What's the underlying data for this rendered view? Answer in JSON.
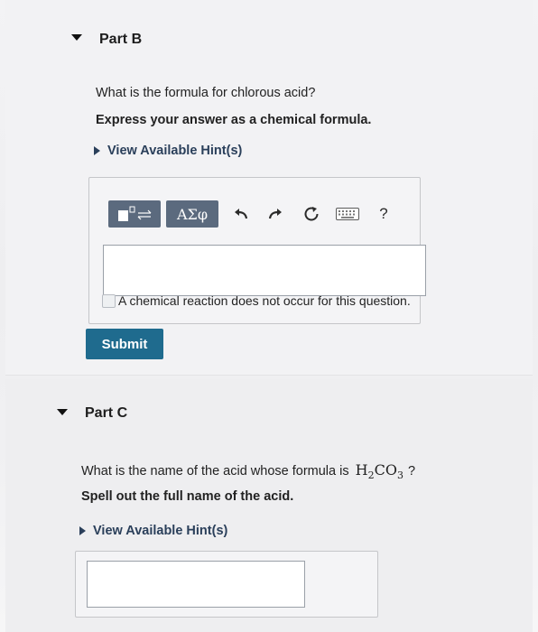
{
  "part_b": {
    "title": "Part B",
    "question": "What is the formula for chlorous acid?",
    "instruction": "Express your answer as a chemical formula.",
    "hint_label": "View Available Hint(s)",
    "toolbar": {
      "template_icon": "template-icon",
      "symbols_label": "ΑΣφ",
      "undo_icon": "undo-icon",
      "redo_icon": "redo-icon",
      "reset_icon": "reset-icon",
      "keyboard_icon": "keyboard-icon",
      "help_label": "?"
    },
    "answer_value": "",
    "no_reaction_label": "A chemical reaction does not occur for this question.",
    "submit_label": "Submit"
  },
  "part_c": {
    "title": "Part C",
    "question_prefix": "What is the name of the acid whose formula is",
    "formula": {
      "base1": "H",
      "sub1": "2",
      "base2": "CO",
      "sub2": "3"
    },
    "question_suffix": " ?",
    "instruction": "Spell out the full name of the acid.",
    "hint_label": "View Available Hint(s)",
    "answer_value": ""
  }
}
